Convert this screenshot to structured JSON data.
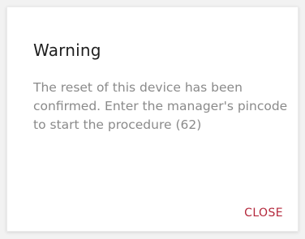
{
  "dialog": {
    "title": "Warning",
    "message": "The reset of this device has been confirmed. Enter the manager's pincode to start the procedure (62)",
    "close_label": "CLOSE"
  },
  "colors": {
    "accent": "#b3263a",
    "title_text": "#1f1f1f",
    "body_text": "#8a8a8a"
  }
}
